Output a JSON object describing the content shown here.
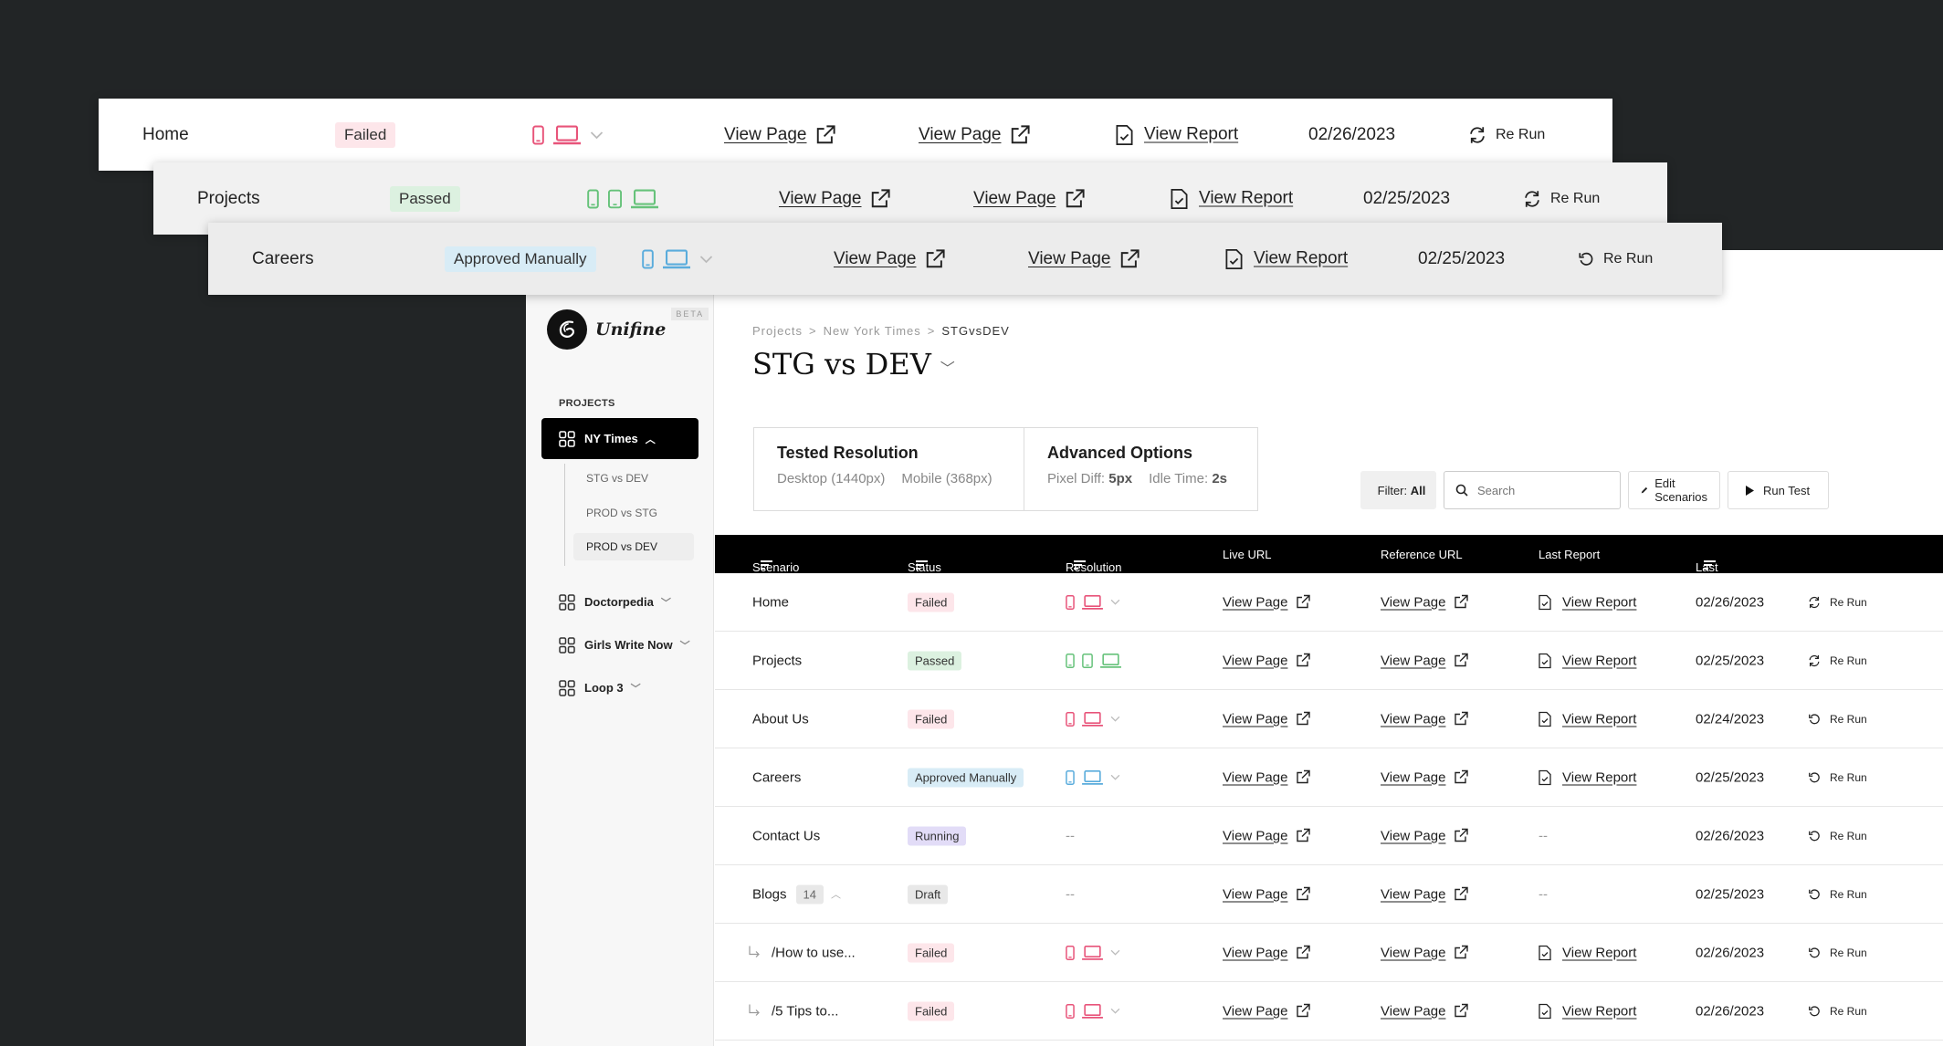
{
  "app": {
    "brand": "Unifine",
    "beta": "BETA"
  },
  "sidebar": {
    "section": "PROJECTS",
    "projects": [
      {
        "label": "NY Times",
        "expanded": true,
        "subitems": [
          "STG vs DEV",
          "PROD vs STG",
          "PROD vs DEV"
        ]
      },
      {
        "label": "Doctorpedia"
      },
      {
        "label": "Girls Write Now"
      },
      {
        "label": "Loop 3"
      }
    ]
  },
  "breadcrumb": {
    "items": [
      "Projects",
      "New York Times",
      "STGvsDEV"
    ],
    "sep": ">"
  },
  "page_title": "STG vs DEV",
  "tested_resolution": {
    "title": "Tested Resolution",
    "desktop": "Desktop (1440px)",
    "mobile": "Mobile (368px)"
  },
  "advanced_options": {
    "title": "Advanced Options",
    "pixel_label": "Pixel Diff:",
    "pixel_value": "5px",
    "idle_label": "Idle Time:",
    "idle_value": "2s"
  },
  "toolbar": {
    "filter_label": "Filter:",
    "filter_value": "All",
    "search_placeholder": "Search",
    "edit_label": "Edit Scenarios",
    "run_label": "Run Test"
  },
  "table": {
    "headers": [
      "Scenario Name",
      "Status",
      "Resolution",
      "Live URL",
      "Reference URL",
      "Last Report",
      "Last Run"
    ],
    "view_page": "View Page",
    "view_report": "View Report",
    "rerun": "Re Run",
    "dash": "--",
    "rows": [
      {
        "name": "Home",
        "status": "Failed",
        "date": "02/26/2023"
      },
      {
        "name": "Projects",
        "status": "Passed",
        "date": "02/25/2023"
      },
      {
        "name": "About Us",
        "status": "Failed",
        "date": "02/24/2023"
      },
      {
        "name": "Careers",
        "status": "Approved Manually",
        "date": "02/25/2023"
      },
      {
        "name": "Contact Us",
        "status": "Running",
        "date": "02/26/2023"
      },
      {
        "name": "Blogs",
        "count": "14",
        "status": "Draft",
        "date": "02/25/2023"
      },
      {
        "name": "/How to use...",
        "status": "Failed",
        "date": "02/26/2023"
      },
      {
        "name": "/5 Tips to...",
        "status": "Failed",
        "date": "02/26/2023"
      }
    ]
  },
  "strips": [
    {
      "name": "Home",
      "status": "Failed",
      "date": "02/26/2023"
    },
    {
      "name": "Projects",
      "status": "Passed",
      "date": "02/25/2023"
    },
    {
      "name": "Careers",
      "status": "Approved Manually",
      "date": "02/25/2023"
    }
  ],
  "colors": {
    "failed": "#e8547a",
    "passed": "#66c27a",
    "approved": "#5aacdc",
    "header": "#000000"
  }
}
